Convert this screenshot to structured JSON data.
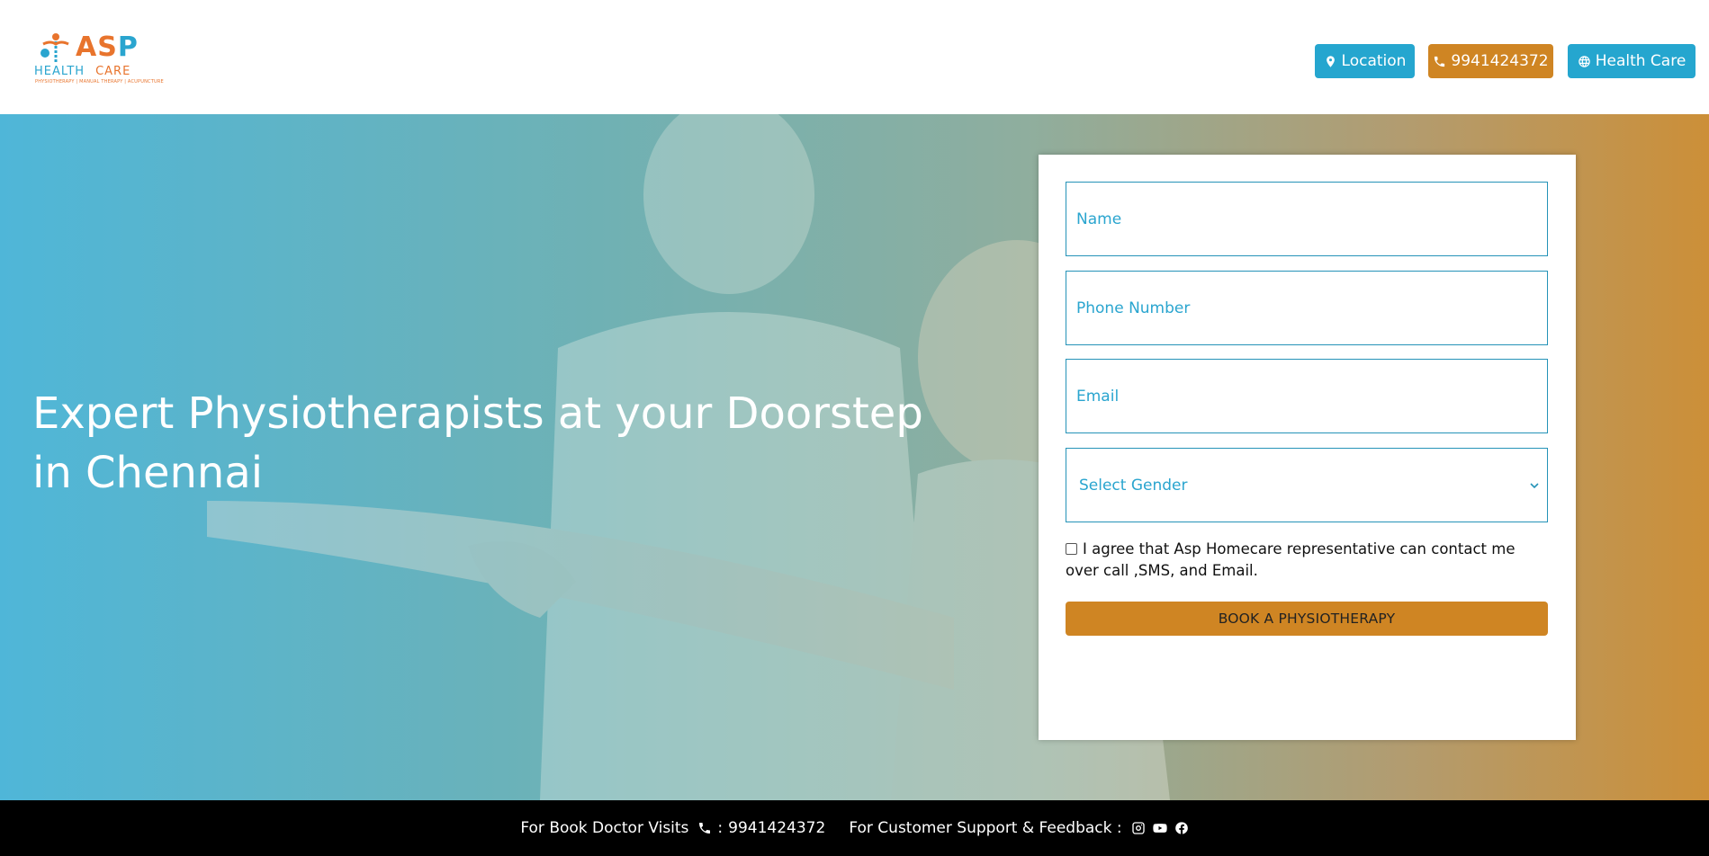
{
  "header": {
    "logo": {
      "brand_a": "AS",
      "brand_p": "P",
      "sub_health": "HEALTH",
      "sub_care": "CARE",
      "tagline": "PHYSIOTHERAPY | MANUAL THERAPY | ACUPUNCTURE"
    },
    "location_label": "Location",
    "phone_label": "9941424372",
    "healthcare_label": "Health Care",
    "colors": {
      "blue": "#25a6cf",
      "orange": "#cf8523"
    }
  },
  "hero": {
    "title": "Expert Physiotherapists at your Doorstep in Chennai"
  },
  "form": {
    "name_placeholder": "Name",
    "phone_placeholder": "Phone Number",
    "email_placeholder": "Email",
    "gender_selected": "Select Gender",
    "consent_text": "I agree that Asp Homecare representative can contact me over call ,SMS, and Email.",
    "submit_label": "BOOK A PHYSIOTHERAPY"
  },
  "footer": {
    "book_label": "For Book Doctor Visits",
    "book_sep": ":",
    "book_phone": "9941424372",
    "support_label": "For Customer Support & Feedback :",
    "icons": [
      "phone-icon",
      "instagram-icon",
      "youtube-icon",
      "facebook-icon"
    ]
  }
}
